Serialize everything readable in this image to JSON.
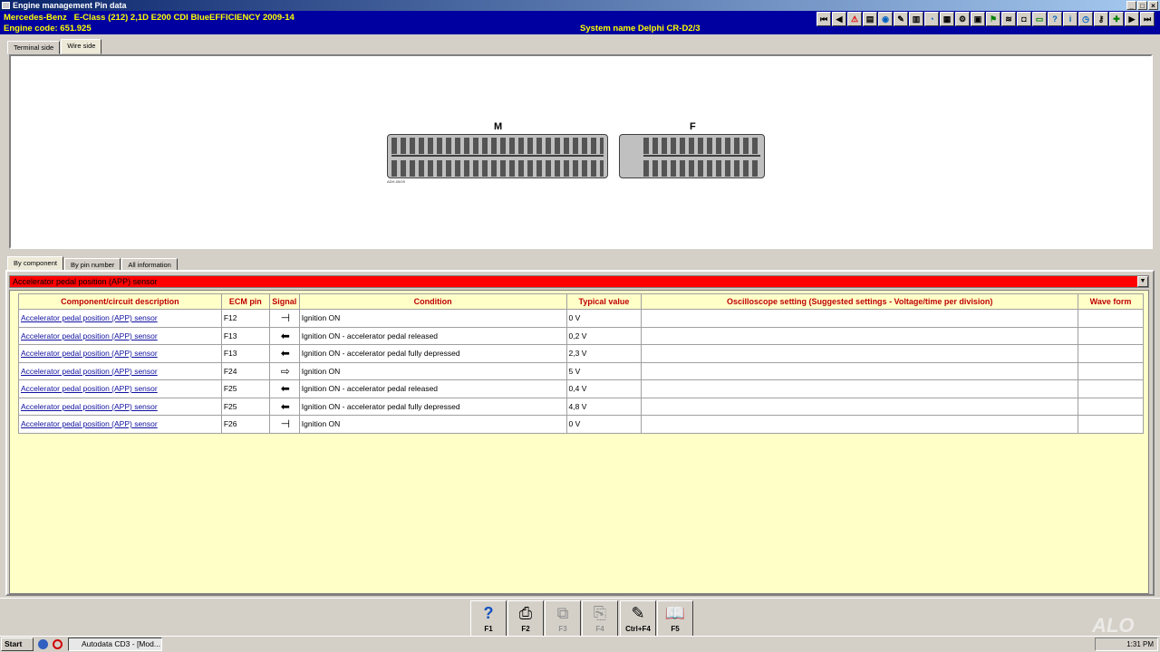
{
  "window": {
    "title": "Engine management Pin data"
  },
  "vehicle": {
    "line1": "Mercedes-Benz   E-Class (212) 2,1D E200 CDI BlueEFFICIENCY 2009-14",
    "engine_code": "Engine code: 651.925",
    "system_name": "System name Delphi CR-D2/3"
  },
  "toolbar_icons": [
    "first-icon",
    "prev-icon",
    "warning-icon",
    "doc-icon",
    "globe-icon",
    "tools-icon",
    "book-icon",
    "gauge-icon",
    "chart-icon",
    "settings-icon",
    "save-icon",
    "flag-icon",
    "wiring-icon",
    "car-icon",
    "battery-icon",
    "help-icon",
    "info-icon",
    "timing-icon",
    "key-icon",
    "service-icon",
    "next-icon",
    "last-icon"
  ],
  "top_tabs": [
    "Terminal side",
    "Wire side"
  ],
  "connectors": {
    "m_label": "M",
    "f_label": "F",
    "code": "ADH-05/09"
  },
  "lower_tabs": [
    "By component",
    "By pin number",
    "All information"
  ],
  "component_select": "Accelerator pedal position (APP) sensor",
  "table": {
    "headers": [
      "Component/circuit description",
      "ECM pin",
      "Signal",
      "Condition",
      "Typical value",
      "Oscilloscope setting (Suggested settings - Voltage/time per division)",
      "Wave form"
    ],
    "rows": [
      {
        "desc": "Accelerator pedal position (APP) sensor",
        "pin": "F12",
        "signal": "ground-icon",
        "condition": "Ignition ON",
        "value": "0 V"
      },
      {
        "desc": "Accelerator pedal position (APP) sensor",
        "pin": "F13",
        "signal": "input-arrow-icon",
        "condition": "Ignition ON - accelerator pedal released",
        "value": "0,2 V"
      },
      {
        "desc": "Accelerator pedal position (APP) sensor",
        "pin": "F13",
        "signal": "input-arrow-icon",
        "condition": "Ignition ON - accelerator pedal fully depressed",
        "value": "2,3 V"
      },
      {
        "desc": "Accelerator pedal position (APP) sensor",
        "pin": "F24",
        "signal": "supply-arrow-icon",
        "condition": "Ignition ON",
        "value": "5 V"
      },
      {
        "desc": "Accelerator pedal position (APP) sensor",
        "pin": "F25",
        "signal": "input-arrow-icon",
        "condition": "Ignition ON - accelerator pedal released",
        "value": "0,4 V"
      },
      {
        "desc": "Accelerator pedal position (APP) sensor",
        "pin": "F25",
        "signal": "input-arrow-icon",
        "condition": "Ignition ON - accelerator pedal fully depressed",
        "value": "4,8 V"
      },
      {
        "desc": "Accelerator pedal position (APP) sensor",
        "pin": "F26",
        "signal": "ground-icon",
        "condition": "Ignition ON",
        "value": "0 V"
      }
    ]
  },
  "function_buttons": [
    {
      "label": "F1",
      "icon": "help-icon"
    },
    {
      "label": "F2",
      "icon": "print-icon"
    },
    {
      "label": "F3",
      "icon": "copy-icon"
    },
    {
      "label": "F4",
      "icon": "print-preview-icon"
    },
    {
      "label": "Ctrl+F4",
      "icon": "notes-icon"
    },
    {
      "label": "F5",
      "icon": "manual-icon"
    }
  ],
  "taskbar": {
    "start": "Start",
    "app": "Autodata CD3 - [Mod...",
    "clock": "1:31 PM"
  },
  "watermark": "ALO"
}
